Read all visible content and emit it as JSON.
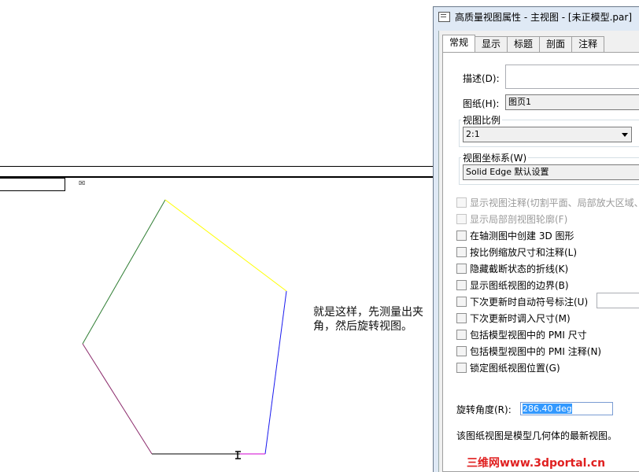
{
  "canvas": {
    "annotation": "就是这样，先测量出夹角，然后旋转视图。"
  },
  "dialog": {
    "title": "高质量视图属性 - 主视图 - [未正模型.par]",
    "tabs": [
      {
        "label": "常规"
      },
      {
        "label": "显示"
      },
      {
        "label": "标题"
      },
      {
        "label": "剖面"
      },
      {
        "label": "注释"
      }
    ],
    "description": {
      "label": "描述(D):",
      "value": ""
    },
    "sheet": {
      "label": "图纸(H):",
      "value": "图页1"
    },
    "scale": {
      "group_label": "视图比例",
      "value": "2:1"
    },
    "coord": {
      "group_label": "视图坐标系(W)",
      "value": "Solid Edge 默认设置"
    },
    "checkboxes": [
      {
        "label": "显示视图注释(切割平面、局部放大区域、",
        "enabled": false,
        "checked": false
      },
      {
        "label": "显示局部剖视图轮廓(F)",
        "enabled": false,
        "checked": false
      },
      {
        "label": "在轴测图中创建 3D 图形",
        "enabled": true,
        "checked": false
      },
      {
        "label": "按比例缩放尺寸和注释(L)",
        "enabled": true,
        "checked": false
      },
      {
        "label": "隐藏截断状态的折线(K)",
        "enabled": true,
        "checked": false
      },
      {
        "label": "显示图纸视图的边界(B)",
        "enabled": true,
        "checked": false
      },
      {
        "label": "下次更新时自动符号标注(U)",
        "enabled": true,
        "checked": false
      },
      {
        "label": "下次更新时调入尺寸(M)",
        "enabled": true,
        "checked": false
      },
      {
        "label": "包括模型视图中的 PMI 尺寸",
        "enabled": true,
        "checked": false
      },
      {
        "label": "包括模型视图中的 PMI 注释(N)",
        "enabled": true,
        "checked": false
      },
      {
        "label": "锁定图纸视图位置(G)",
        "enabled": true,
        "checked": false
      }
    ],
    "rotation": {
      "label": "旋转角度(R):",
      "value": "286.40 deg"
    },
    "status": "该图纸视图是模型几何体的最新视图。"
  },
  "watermark": "三维网www.3dportal.cn",
  "colors": {
    "edge_green": "#2e7d32",
    "edge_yellow": "#ffff00",
    "edge_blue": "#1a1aee",
    "edge_purple": "#8b2a6b",
    "edge_black": "#000000",
    "edge_magenta": "#d000d0",
    "selection": "#3399ff",
    "watermark": "#e02020"
  }
}
